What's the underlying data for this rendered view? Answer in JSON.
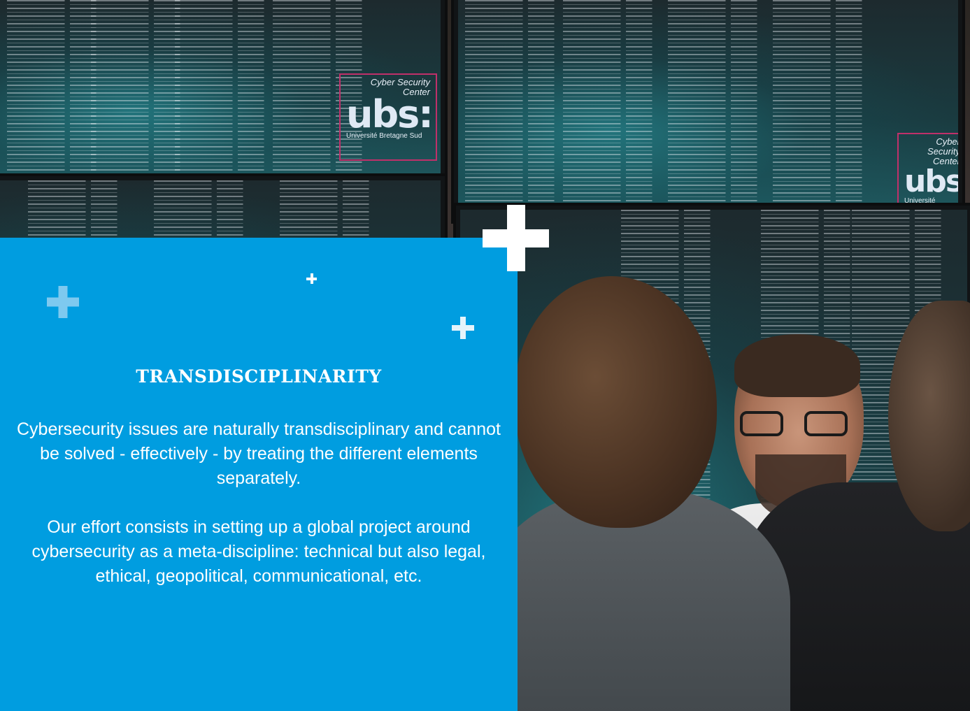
{
  "section": {
    "title": "TRANSDISCIPLINARITY",
    "paragraphs": [
      "Cybersecurity issues are naturally transdisciplinary and cannot be solved - effectively - by treating the different elements separately.",
      "Our effort consists in setting up a global project around cybersecurity as a meta-discipline: technical but also legal, ethical, geopolitical, communicational, etc."
    ]
  },
  "photo": {
    "logo": {
      "top_line": "Cyber Security",
      "second_line": "Center",
      "wordmark": "ubs:",
      "footer": "Université Bretagne Sud"
    }
  },
  "colors": {
    "panel_background": "#009de0",
    "text": "#ffffff",
    "plus_light": "#ffffff",
    "plus_faded": "#7ec9ef"
  },
  "decorations": [
    "plus-icon",
    "plus-icon",
    "plus-icon",
    "plus-icon"
  ]
}
